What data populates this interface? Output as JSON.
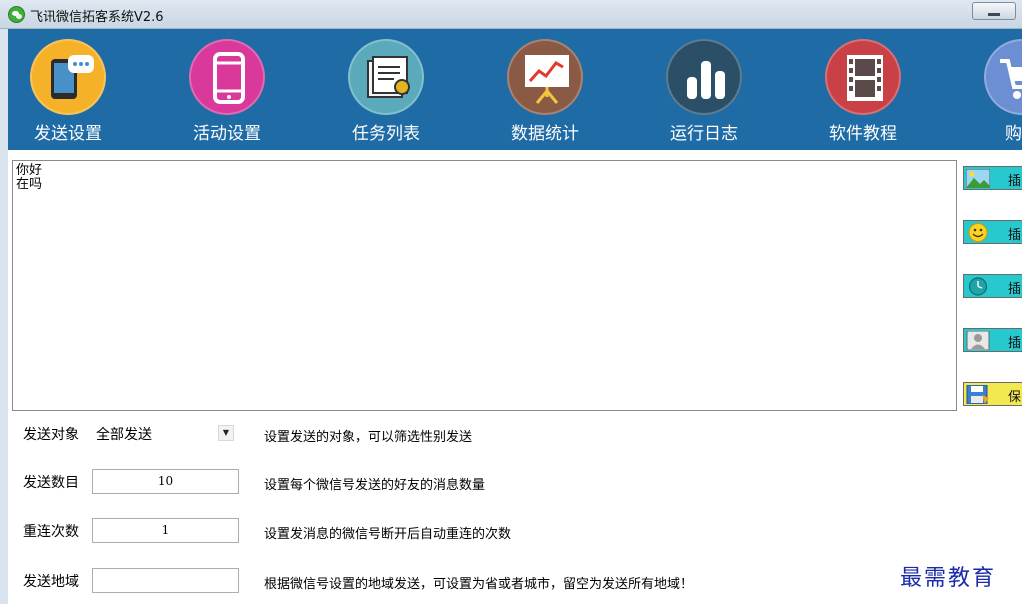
{
  "window": {
    "title": "飞讯微信拓客系统V2.6"
  },
  "toolbar": {
    "items": [
      {
        "label": "发送设置",
        "icon": "phone-chat-icon",
        "color": "#f5b128"
      },
      {
        "label": "活动设置",
        "icon": "mobile-phone-icon",
        "color": "#d8399a"
      },
      {
        "label": "任务列表",
        "icon": "certificate-list-icon",
        "color": "#5aaabb"
      },
      {
        "label": "数据统计",
        "icon": "presentation-chart-icon",
        "color": "#8a5a45"
      },
      {
        "label": "运行日志",
        "icon": "bar-chart-icon",
        "color": "#2a4f67"
      },
      {
        "label": "软件教程",
        "icon": "film-icon",
        "color": "#c94047"
      },
      {
        "label": "购买",
        "icon": "shopping-cart-icon",
        "color": "#6c8fd4"
      }
    ]
  },
  "message": {
    "lines": [
      "你好",
      "在吗"
    ]
  },
  "side_buttons": [
    {
      "label": "插",
      "icon": "image-icon"
    },
    {
      "label": "插",
      "icon": "smiley-icon"
    },
    {
      "label": "插",
      "icon": "clock-icon"
    },
    {
      "label": "插",
      "icon": "contact-card-icon"
    },
    {
      "label": "保",
      "icon": "save-icon"
    }
  ],
  "form": {
    "target": {
      "label": "发送对象",
      "value": "全部发送",
      "desc": "设置发送的对象，可以筛选性别发送"
    },
    "count": {
      "label": "发送数目",
      "value": "10",
      "desc": "设置每个微信号发送的好友的消息数量"
    },
    "reconnect": {
      "label": "重连次数",
      "value": "1",
      "desc": "设置发消息的微信号断开后自动重连的次数"
    },
    "region": {
      "label": "发送地域",
      "value": "",
      "desc": "根据微信号设置的地域发送，可设置为省或者城市，留空为发送所有地域！"
    }
  },
  "watermark": "最需教育"
}
